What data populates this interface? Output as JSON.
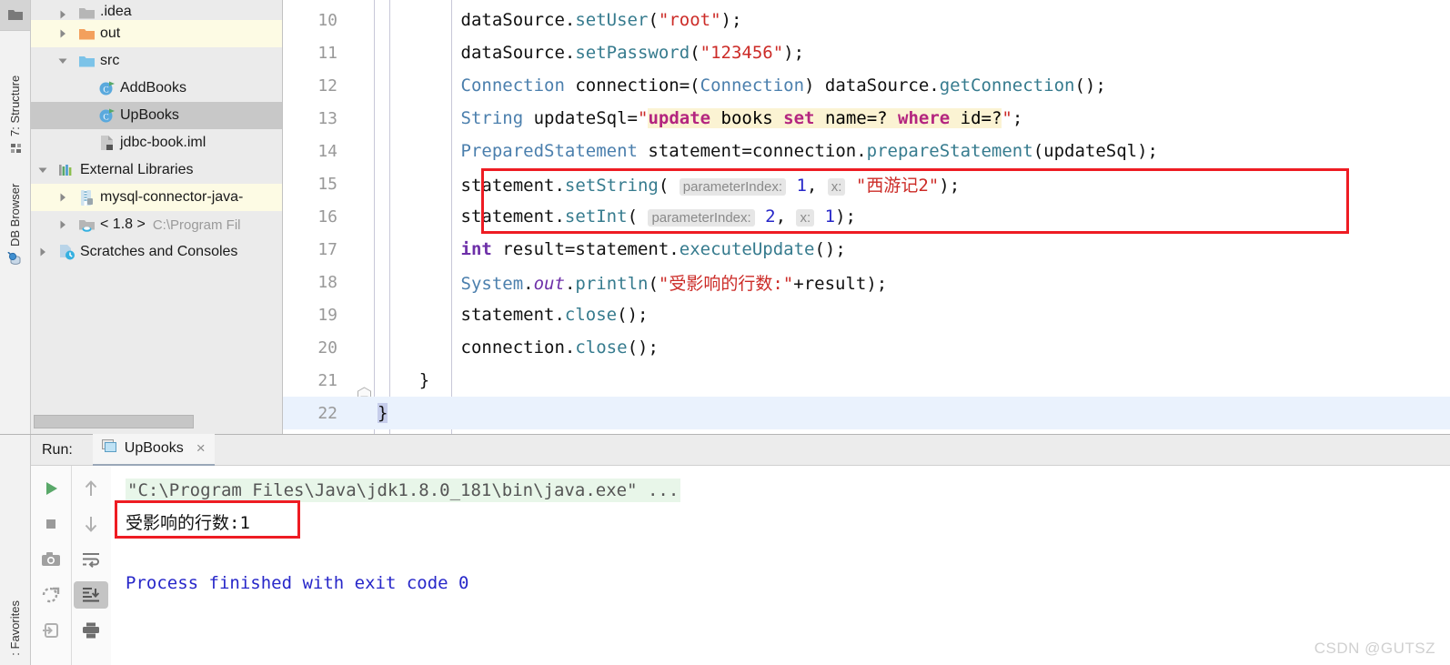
{
  "left_strip": {
    "top_icon": "folder-icon",
    "items": [
      {
        "label": "7: Structure",
        "icon": "structure-icon"
      },
      {
        "label": "DB Browser",
        "icon": "db-browser-icon"
      }
    ]
  },
  "project_tree": {
    "rows": [
      {
        "label": ".idea",
        "icon": "folder-grey-icon",
        "arrow": "collapsed",
        "indent": 1,
        "state": "partial"
      },
      {
        "label": "out",
        "icon": "folder-orange-icon",
        "arrow": "collapsed",
        "indent": 1,
        "state": "highlight"
      },
      {
        "label": "src",
        "icon": "folder-blue-icon",
        "arrow": "expanded",
        "indent": 1,
        "state": "normal"
      },
      {
        "label": "AddBooks",
        "icon": "java-class-icon",
        "arrow": "none",
        "indent": 2,
        "state": "normal"
      },
      {
        "label": "UpBooks",
        "icon": "java-class-icon",
        "arrow": "none",
        "indent": 2,
        "state": "selected"
      },
      {
        "label": "jdbc-book.iml",
        "icon": "iml-file-icon",
        "arrow": "none",
        "indent": 2,
        "state": "normal"
      },
      {
        "label": "External Libraries",
        "icon": "library-icon",
        "arrow": "expanded",
        "indent": 0,
        "state": "normal"
      },
      {
        "label": "mysql-connector-java-",
        "icon": "jar-icon",
        "arrow": "collapsed",
        "indent": 1,
        "state": "highlight"
      },
      {
        "label": "< 1.8 >",
        "icon": "jdk-icon",
        "arrow": "collapsed",
        "indent": 1,
        "state": "normal",
        "sub": "C:\\Program Fil"
      },
      {
        "label": "Scratches and Consoles",
        "icon": "scratches-icon",
        "arrow": "collapsed",
        "indent": 0,
        "state": "normal"
      }
    ]
  },
  "editor": {
    "lines": [
      {
        "num": "10",
        "tokens": [
          {
            "t": "        ",
            "c": "k-plain"
          },
          {
            "t": "dataSource",
            "c": "k-plain"
          },
          {
            "t": ".",
            "c": "k-plain"
          },
          {
            "t": "setUser",
            "c": "k-meth"
          },
          {
            "t": "(",
            "c": "k-plain"
          },
          {
            "t": "\"root\"",
            "c": "k-str"
          },
          {
            "t": ");",
            "c": "k-plain"
          }
        ]
      },
      {
        "num": "11",
        "tokens": [
          {
            "t": "        ",
            "c": "k-plain"
          },
          {
            "t": "dataSource",
            "c": "k-plain"
          },
          {
            "t": ".",
            "c": "k-plain"
          },
          {
            "t": "setPassword",
            "c": "k-meth"
          },
          {
            "t": "(",
            "c": "k-plain"
          },
          {
            "t": "\"123456\"",
            "c": "k-str"
          },
          {
            "t": ");",
            "c": "k-plain"
          }
        ]
      },
      {
        "num": "12",
        "tokens": [
          {
            "t": "        ",
            "c": "k-plain"
          },
          {
            "t": "Connection",
            "c": "k-type"
          },
          {
            "t": " connection=(",
            "c": "k-plain"
          },
          {
            "t": "Connection",
            "c": "k-type"
          },
          {
            "t": ") dataSource.",
            "c": "k-plain"
          },
          {
            "t": "getConnection",
            "c": "k-meth"
          },
          {
            "t": "();",
            "c": "k-plain"
          }
        ]
      },
      {
        "num": "13",
        "tokens": [
          {
            "t": "        ",
            "c": "k-plain"
          },
          {
            "t": "String",
            "c": "k-type"
          },
          {
            "t": " updateSql=",
            "c": "k-plain"
          },
          {
            "t": "\"",
            "c": "k-str"
          },
          {
            "t": "update",
            "c": "sqlkw sqlhl"
          },
          {
            "t": " books ",
            "c": "sqlhl"
          },
          {
            "t": "set",
            "c": "sqlkw sqlhl"
          },
          {
            "t": " name=? ",
            "c": "sqlhl"
          },
          {
            "t": "where",
            "c": "sqlkw sqlhl"
          },
          {
            "t": " id=?",
            "c": "sqlhl"
          },
          {
            "t": "\"",
            "c": "k-str"
          },
          {
            "t": ";",
            "c": "k-plain"
          }
        ]
      },
      {
        "num": "14",
        "tokens": [
          {
            "t": "        ",
            "c": "k-plain"
          },
          {
            "t": "PreparedStatement",
            "c": "k-type"
          },
          {
            "t": " statement=connection.",
            "c": "k-plain"
          },
          {
            "t": "prepareStatement",
            "c": "k-meth"
          },
          {
            "t": "(updateSql);",
            "c": "k-plain"
          }
        ]
      },
      {
        "num": "15",
        "tokens": [
          {
            "t": "        ",
            "c": "k-plain"
          },
          {
            "t": "statement",
            "c": "k-plain"
          },
          {
            "t": ".",
            "c": "k-plain"
          },
          {
            "t": "setString",
            "c": "k-meth"
          },
          {
            "t": "( ",
            "c": "k-plain"
          },
          {
            "t": "parameterIndex:",
            "c": "hint"
          },
          {
            "t": " ",
            "c": "k-plain"
          },
          {
            "t": "1",
            "c": "k-num"
          },
          {
            "t": ", ",
            "c": "k-plain"
          },
          {
            "t": "x:",
            "c": "hint"
          },
          {
            "t": " ",
            "c": "k-plain"
          },
          {
            "t": "\"西游记2\"",
            "c": "k-str"
          },
          {
            "t": ");",
            "c": "k-plain"
          }
        ]
      },
      {
        "num": "16",
        "tokens": [
          {
            "t": "        ",
            "c": "k-plain"
          },
          {
            "t": "statement",
            "c": "k-plain"
          },
          {
            "t": ".",
            "c": "k-plain"
          },
          {
            "t": "setInt",
            "c": "k-meth"
          },
          {
            "t": "( ",
            "c": "k-plain"
          },
          {
            "t": "parameterIndex:",
            "c": "hint"
          },
          {
            "t": " ",
            "c": "k-plain"
          },
          {
            "t": "2",
            "c": "k-num"
          },
          {
            "t": ", ",
            "c": "k-plain"
          },
          {
            "t": "x:",
            "c": "hint"
          },
          {
            "t": " ",
            "c": "k-plain"
          },
          {
            "t": "1",
            "c": "k-num"
          },
          {
            "t": ");",
            "c": "k-plain"
          }
        ]
      },
      {
        "num": "17",
        "tokens": [
          {
            "t": "        ",
            "c": "k-plain"
          },
          {
            "t": "int",
            "c": "k-kw"
          },
          {
            "t": " result=statement.",
            "c": "k-plain"
          },
          {
            "t": "executeUpdate",
            "c": "k-meth"
          },
          {
            "t": "();",
            "c": "k-plain"
          }
        ]
      },
      {
        "num": "18",
        "tokens": [
          {
            "t": "        ",
            "c": "k-plain"
          },
          {
            "t": "System",
            "c": "k-type"
          },
          {
            "t": ".",
            "c": "k-plain"
          },
          {
            "t": "out",
            "c": "k-static"
          },
          {
            "t": ".",
            "c": "k-plain"
          },
          {
            "t": "println",
            "c": "k-meth"
          },
          {
            "t": "(",
            "c": "k-plain"
          },
          {
            "t": "\"受影响的行数:\"",
            "c": "k-str"
          },
          {
            "t": "+result);",
            "c": "k-plain"
          }
        ]
      },
      {
        "num": "19",
        "tokens": [
          {
            "t": "        ",
            "c": "k-plain"
          },
          {
            "t": "statement",
            "c": "k-plain"
          },
          {
            "t": ".",
            "c": "k-plain"
          },
          {
            "t": "close",
            "c": "k-meth"
          },
          {
            "t": "();",
            "c": "k-plain"
          }
        ]
      },
      {
        "num": "20",
        "tokens": [
          {
            "t": "        ",
            "c": "k-plain"
          },
          {
            "t": "connection",
            "c": "k-plain"
          },
          {
            "t": ".",
            "c": "k-plain"
          },
          {
            "t": "close",
            "c": "k-meth"
          },
          {
            "t": "();",
            "c": "k-plain"
          }
        ]
      },
      {
        "num": "21",
        "tokens": [
          {
            "t": "    }",
            "c": "k-plain"
          }
        ],
        "fold": true
      },
      {
        "num": "22",
        "tokens": [
          {
            "t": "}",
            "c": "k-plain selbrace"
          }
        ],
        "caret": true
      }
    ]
  },
  "run_panel": {
    "label": "Run:",
    "tab": {
      "title": "UpBooks",
      "icon": "console-icon",
      "close": "×"
    },
    "toolbar_left": [
      "run-icon",
      "stop-icon",
      "camera-icon",
      "rerun-failed-icon",
      "export-icon"
    ],
    "toolbar_right": [
      "up-arrow-icon",
      "down-arrow-icon",
      "soft-wrap-icon",
      "scroll-to-end-icon",
      "print-icon"
    ],
    "console": [
      {
        "text": "\"C:\\Program Files\\Java\\jdk1.8.0_181\\bin\\java.exe\" ...",
        "style": "cmd"
      },
      {
        "text": "受影响的行数:1",
        "style": "out"
      },
      {
        "text": "",
        "style": "out"
      },
      {
        "text": "Process finished with exit code 0",
        "style": "finish"
      }
    ]
  },
  "favorites_label": ": Favorites",
  "watermark": "CSDN @GUTSZ",
  "colors": {
    "highlight_red": "#ee1c23",
    "caret_line": "#eaf2fd",
    "sql_highlight": "#fbf3d3",
    "cmd_bg": "#e8f6e9",
    "tree_highlight": "#fdfbe4",
    "tree_selected": "#c8c8c8"
  }
}
